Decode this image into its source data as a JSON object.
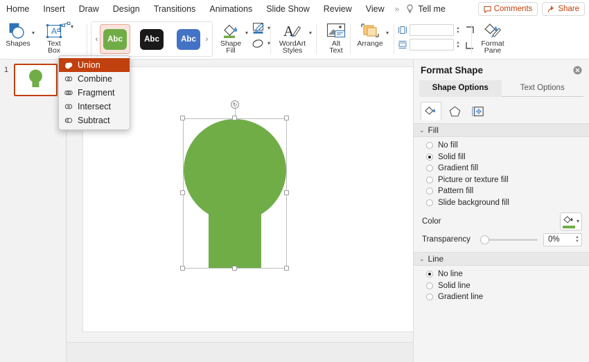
{
  "menubar": {
    "items": [
      {
        "label": "Home"
      },
      {
        "label": "Insert"
      },
      {
        "label": "Draw"
      },
      {
        "label": "Design"
      },
      {
        "label": "Transitions"
      },
      {
        "label": "Animations"
      },
      {
        "label": "Slide Show"
      },
      {
        "label": "Review"
      },
      {
        "label": "View"
      }
    ],
    "overflow": "»",
    "tell_me": "Tell me",
    "comments": "Comments",
    "share": "Share",
    "accent_color": "#c0400e"
  },
  "ribbon": {
    "shapes_label": "Shapes",
    "textbox_label_line1": "Text",
    "textbox_label_line2": "Box",
    "merge_shapes_name": "merge-shapes",
    "gallery": {
      "prev": "‹",
      "next": "›",
      "items": [
        {
          "label": "Abc",
          "color": "#70ad47",
          "selected": true
        },
        {
          "label": "Abc",
          "color": "#1a1a1a",
          "selected": false
        },
        {
          "label": "Abc",
          "color": "#4472c4",
          "selected": false
        }
      ]
    },
    "shape_fill_line1": "Shape",
    "shape_fill_line2": "Fill",
    "shape_fill_color": "#70ad47",
    "wordart_line1": "WordArt",
    "wordart_line2": "Styles",
    "alttext_line1": "Alt",
    "alttext_line2": "Text",
    "arrange_label": "Arrange",
    "height_value": "",
    "width_value": "",
    "format_pane_line1": "Format",
    "format_pane_line2": "Pane"
  },
  "dropdown": {
    "items": [
      {
        "label": "Union",
        "icon": "union-icon",
        "active": true
      },
      {
        "label": "Combine",
        "icon": "combine-icon",
        "active": false
      },
      {
        "label": "Fragment",
        "icon": "fragment-icon",
        "active": false
      },
      {
        "label": "Intersect",
        "icon": "intersect-icon",
        "active": false
      },
      {
        "label": "Subtract",
        "icon": "subtract-icon",
        "active": false
      }
    ],
    "highlight_color": "#c0400e"
  },
  "slides": {
    "current_number": "1",
    "shape_color": "#70ad47",
    "selected_border": "#c0400e"
  },
  "canvas": {
    "shape_color": "#70ad47",
    "rotate_glyph": "↻"
  },
  "format_pane": {
    "title": "Format Shape",
    "close": "✕",
    "tabs": [
      {
        "label": "Shape Options",
        "active": true
      },
      {
        "label": "Text Options",
        "active": false
      }
    ],
    "icon_tabs": [
      {
        "name": "fill-bucket-icon",
        "active": true
      },
      {
        "name": "pentagon-effects-icon",
        "active": false
      },
      {
        "name": "size-layout-icon",
        "active": false
      }
    ],
    "fill": {
      "header": "Fill",
      "chevron": "⌄",
      "options": [
        {
          "label": "No fill",
          "selected": false
        },
        {
          "label": "Solid fill",
          "selected": true
        },
        {
          "label": "Gradient fill",
          "selected": false
        },
        {
          "label": "Picture or texture fill",
          "selected": false
        },
        {
          "label": "Pattern fill",
          "selected": false
        },
        {
          "label": "Slide background fill",
          "selected": false
        }
      ],
      "color_label": "Color",
      "color_value": "#70ad47",
      "transparency_label": "Transparency",
      "transparency_value": "0%"
    },
    "line": {
      "header": "Line",
      "chevron": "⌄",
      "options": [
        {
          "label": "No line",
          "selected": true
        },
        {
          "label": "Solid line",
          "selected": false
        },
        {
          "label": "Gradient line",
          "selected": false
        }
      ]
    }
  }
}
